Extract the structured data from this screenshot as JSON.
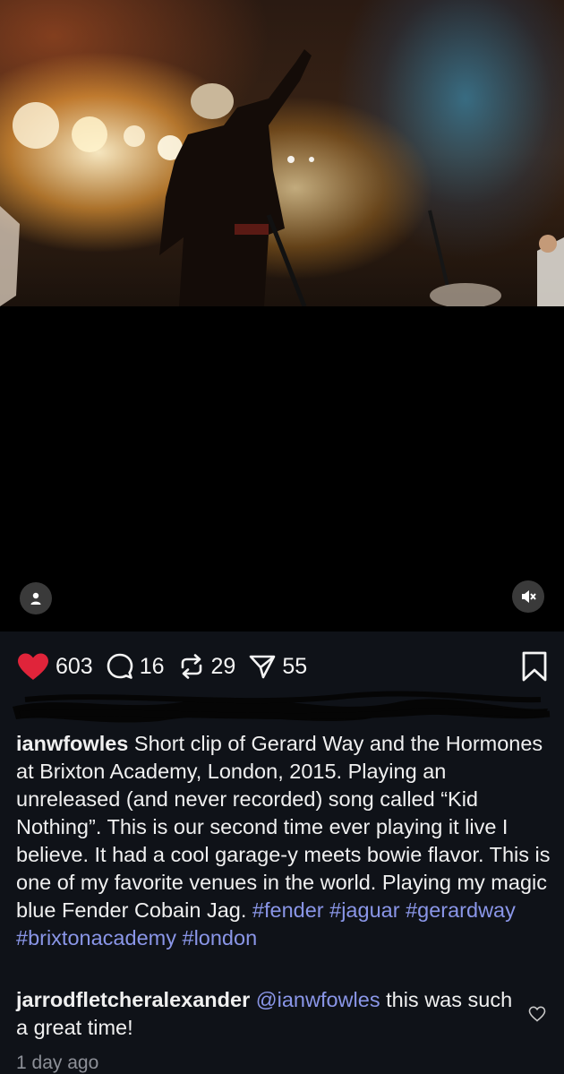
{
  "post": {
    "user_button_icon": "user-icon",
    "mute_button_icon": "speaker-muted-icon",
    "counts": {
      "likes": "603",
      "comments": "16",
      "reposts": "29",
      "shares": "55"
    },
    "caption": {
      "username": "ianwfowles",
      "text": " Short clip of Gerard Way and the Hormones at Brixton Academy, London, 2015. Playing an unreleased (and never recorded) song called “Kid Nothing”. This is our second time ever playing it live I believe. It had a cool garage-y meets bowie flavor. This is one of my favorite venues in the world. Playing my magic blue Fender Cobain Jag. ",
      "hashtags": [
        "#fender",
        "#jaguar",
        "#gerardway",
        "#brixtonacademy",
        "#london"
      ]
    },
    "comment": {
      "username": "jarrodfletcheralexander",
      "mention": "@ianwfowles",
      "text": " this was such a great time!"
    },
    "time": "1 day ago"
  },
  "colors": {
    "like": "#e0243a",
    "link": "#8a96e8",
    "panel_bg": "#0f1218",
    "time": "#8d9098"
  }
}
